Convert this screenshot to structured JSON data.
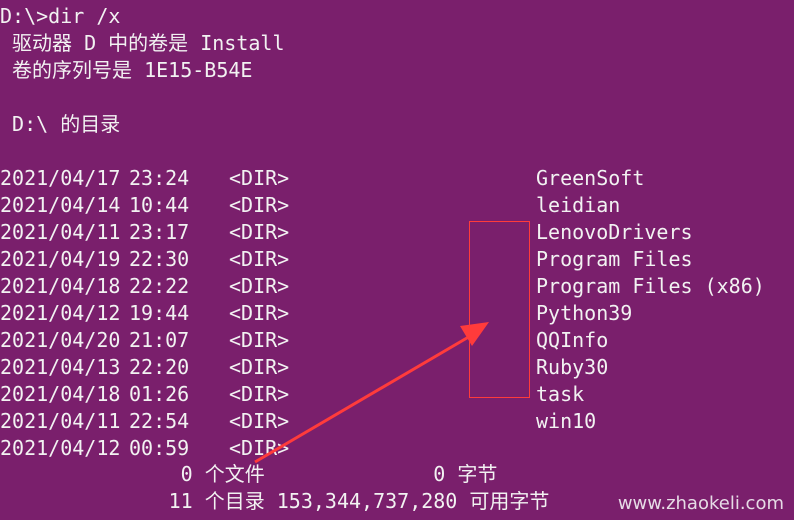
{
  "terminal": {
    "prompt_line": "D:\\>dir /x",
    "volume_line": " 驱动器 D 中的卷是 Install",
    "serial_line": " 卷的序列号是 1E15-B54E",
    "dir_header": " D:\\ 的目录",
    "entries": [
      {
        "date": "2021/04/17",
        "time": "23:24",
        "type": "<DIR>",
        "name": "GreenSoft"
      },
      {
        "date": "2021/04/14",
        "time": "10:44",
        "type": "<DIR>",
        "name": "leidian"
      },
      {
        "date": "2021/04/11",
        "time": "23:17",
        "type": "<DIR>",
        "name": "LenovoDrivers"
      },
      {
        "date": "2021/04/19",
        "time": "22:30",
        "type": "<DIR>",
        "name": "Program Files"
      },
      {
        "date": "2021/04/18",
        "time": "22:22",
        "type": "<DIR>",
        "name": "Program Files (x86)"
      },
      {
        "date": "2021/04/12",
        "time": "19:44",
        "type": "<DIR>",
        "name": "Python39"
      },
      {
        "date": "2021/04/20",
        "time": "21:07",
        "type": "<DIR>",
        "name": "QQInfo"
      },
      {
        "date": "2021/04/13",
        "time": "22:20",
        "type": "<DIR>",
        "name": "Ruby30"
      },
      {
        "date": "2021/04/18",
        "time": "01:26",
        "type": "<DIR>",
        "name": "task"
      },
      {
        "date": "2021/04/11",
        "time": "22:54",
        "type": "<DIR>",
        "name": "win10"
      },
      {
        "date": "2021/04/12",
        "time": "00:59",
        "type": "<DIR>",
        "name": ""
      }
    ],
    "summary_files": "               0 个文件              0 字节",
    "summary_dirs": "              11 个目录 153,344,737,280 可用字节"
  },
  "watermark": "www.zhaokeli.com",
  "colors": {
    "background": "#7a1f6c",
    "text": "#f2f2f2",
    "annotation": "#ff3b3b"
  }
}
